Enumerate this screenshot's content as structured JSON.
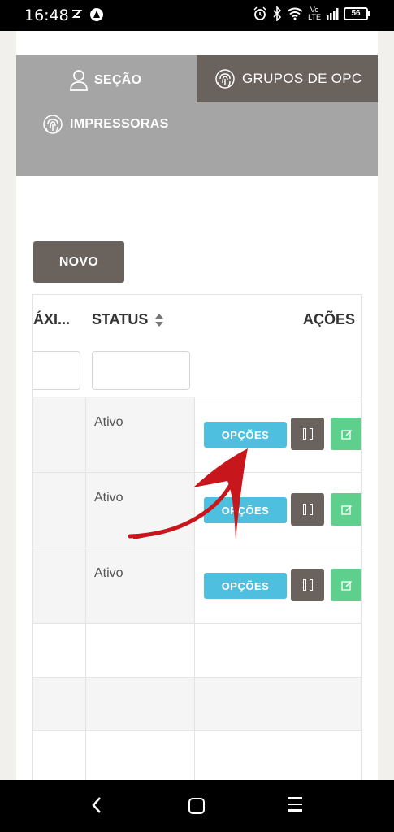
{
  "status_bar": {
    "time": "16:48",
    "battery": "56",
    "network_top": "Vo",
    "network_bottom": "LTE",
    "network_gen": "4G"
  },
  "tabs": [
    {
      "label": "SEÇÃO",
      "icon": "user-icon",
      "active": false
    },
    {
      "label": "GRUPOS DE OPC",
      "icon": "fingerprint-icon",
      "active": true
    },
    {
      "label": "IMPRESSORAS",
      "icon": "fingerprint-icon",
      "active": false
    }
  ],
  "buttons": {
    "novo": "NOVO"
  },
  "table": {
    "columns": {
      "maximo": "ÁXI...",
      "status": "STATUS",
      "acoes": "AÇÕES"
    },
    "rows": [
      {
        "status": "Ativo",
        "opcoes": "OPÇÕES"
      },
      {
        "status": "Ativo",
        "opcoes": "OPÇÕES"
      },
      {
        "status": "Ativo",
        "opcoes": "OPÇÕES"
      }
    ]
  },
  "colors": {
    "accent_dark": "#6a625c",
    "tab_bg": "#a5a5a5",
    "opcoes": "#4fbfe0",
    "edit": "#5fcf8e",
    "arrow": "#c8161d"
  }
}
